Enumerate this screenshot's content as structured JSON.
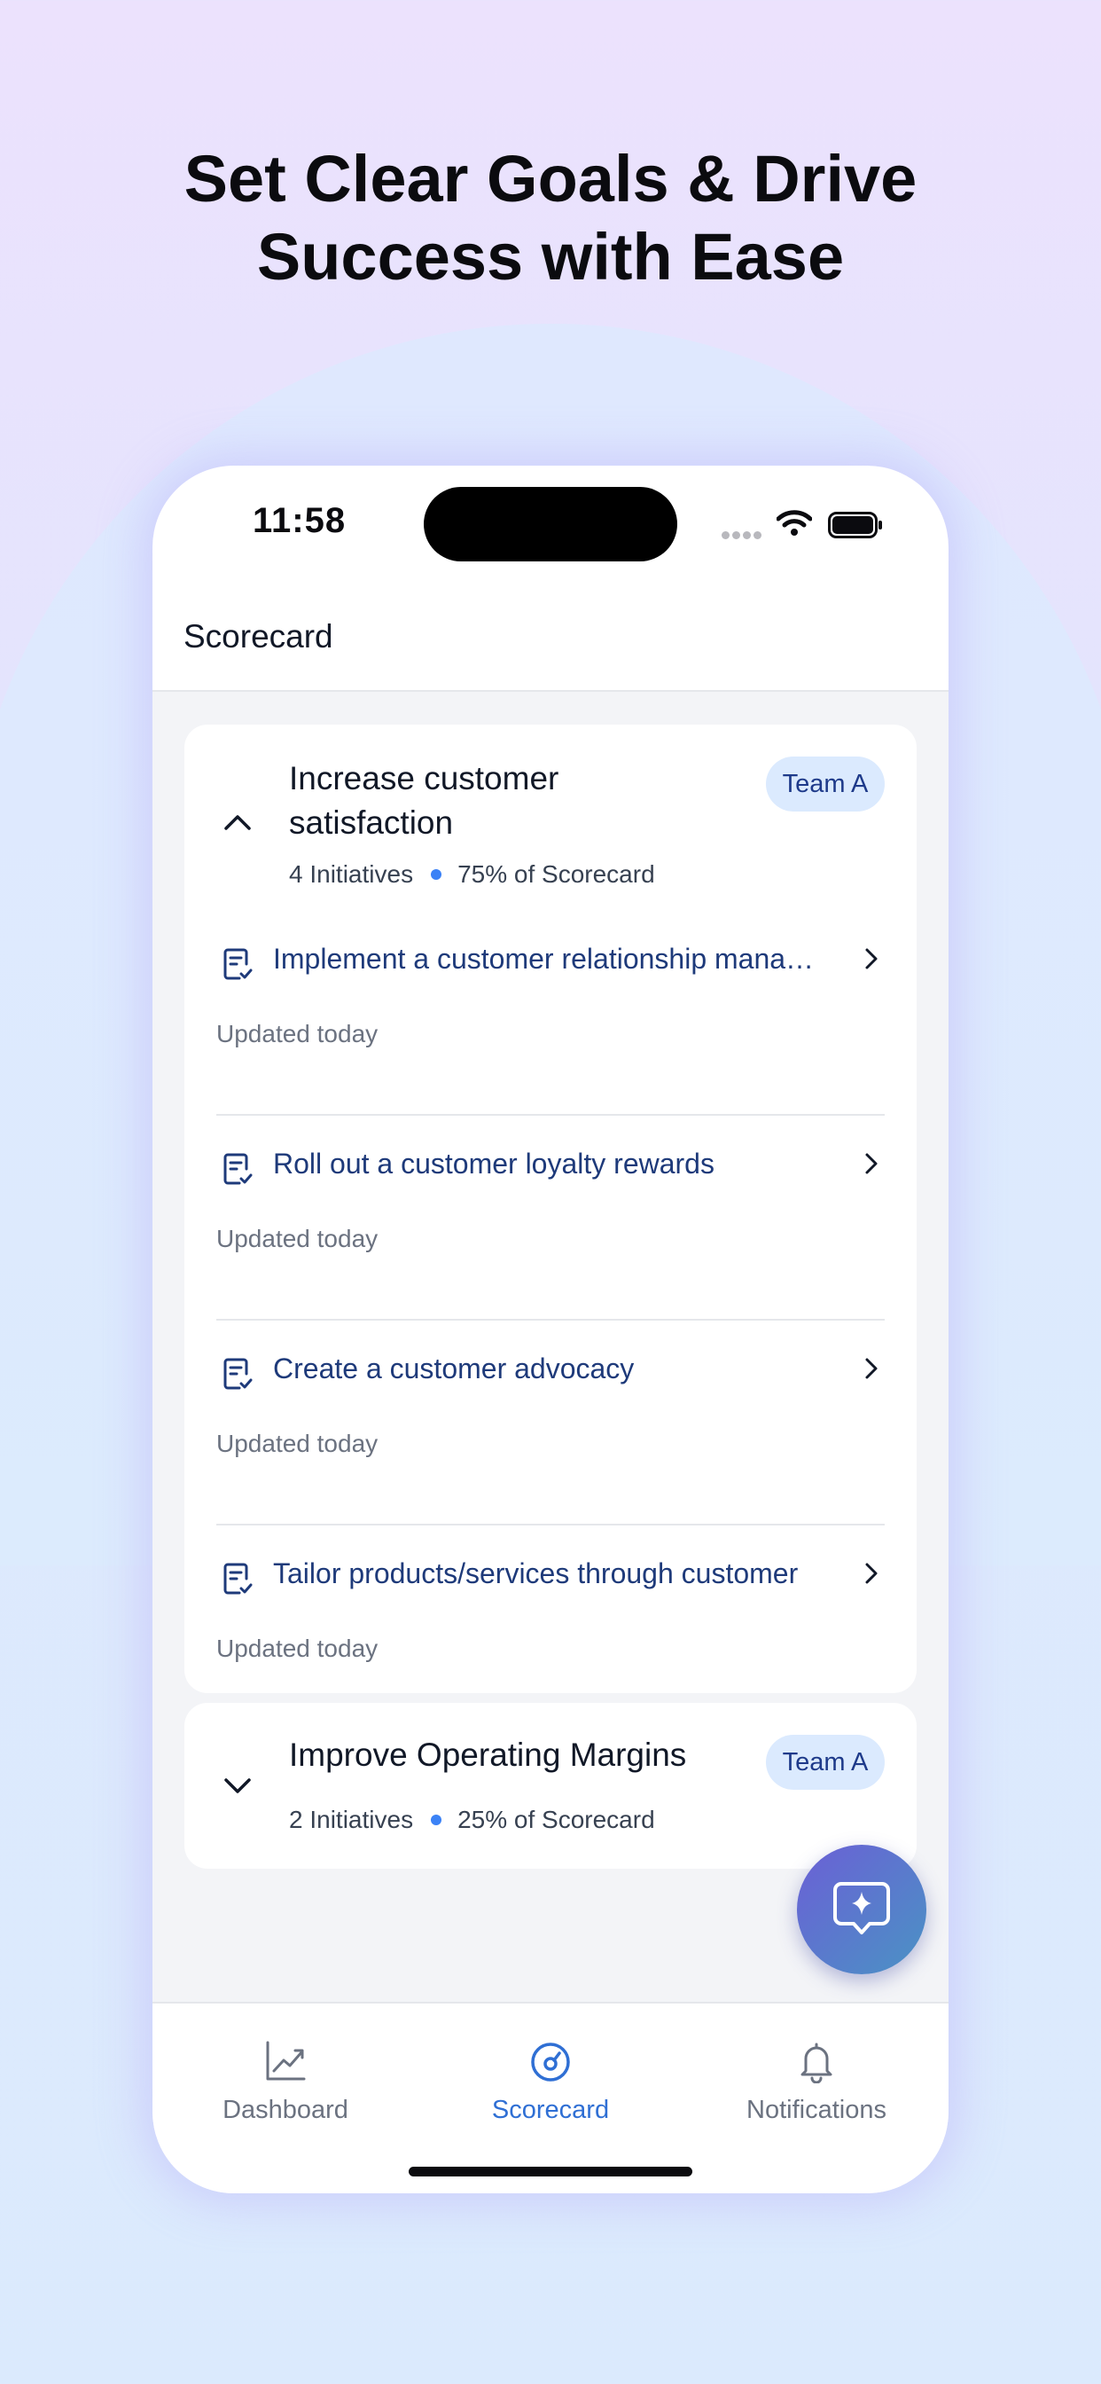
{
  "headline": {
    "line1": "Set Clear Goals & Drive",
    "line2": "Success with Ease"
  },
  "status_bar": {
    "time": "11:58"
  },
  "header": {
    "title": "Scorecard"
  },
  "goals": [
    {
      "title": "Increase customer satisfaction",
      "team": "Team A",
      "initiatives_count": "4 Initiatives",
      "scorecard_share": "75% of Scorecard",
      "expanded": true,
      "initiatives": [
        {
          "title": "Implement a customer relationship management",
          "updated": "Updated today"
        },
        {
          "title": "Roll out a customer loyalty rewards",
          "updated": "Updated today"
        },
        {
          "title": "Create a customer advocacy",
          "updated": "Updated today"
        },
        {
          "title": "Tailor products/services through customer",
          "updated": "Updated today"
        }
      ]
    },
    {
      "title": "Improve Operating Margins",
      "team": "Team A",
      "initiatives_count": "2 Initiatives",
      "scorecard_share": "25% of Scorecard",
      "expanded": false
    }
  ],
  "tabs": [
    {
      "label": "Dashboard",
      "icon": "chart-line-icon",
      "active": false
    },
    {
      "label": "Scorecard",
      "icon": "gauge-icon",
      "active": true
    },
    {
      "label": "Notifications",
      "icon": "bell-icon",
      "active": false
    }
  ],
  "fab": {
    "icon": "ai-sparkle-chat-icon"
  },
  "colors": {
    "accent": "#2f6fd4",
    "initiative_text": "#1e3a7a",
    "badge_bg": "#dbeafe"
  }
}
